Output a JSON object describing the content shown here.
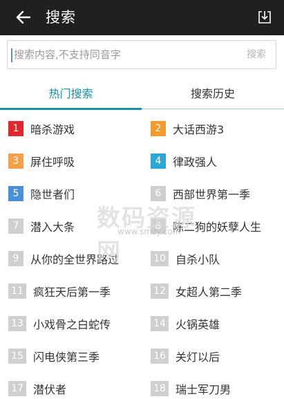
{
  "header": {
    "title": "搜索",
    "back_icon": "arrow-left-icon",
    "download_icon": "download-icon"
  },
  "search": {
    "placeholder": "搜索内容,不支持同音字",
    "button_label": "搜索"
  },
  "tabs": [
    {
      "label": "热门搜索",
      "active": true
    },
    {
      "label": "搜索历史",
      "active": false
    }
  ],
  "colors": {
    "header_bg": "#202020",
    "accent": "#1b8fa5",
    "rank_1": "#e0272b",
    "rank_2": "#f39a2a",
    "rank_3": "#f5a04a",
    "rank_4": "#29a8d8",
    "rank_5": "#4a90d9",
    "rank_other": "#cfcfcf"
  },
  "hot_items": [
    {
      "rank": "1",
      "label": "暗杀游戏"
    },
    {
      "rank": "2",
      "label": "大话西游3"
    },
    {
      "rank": "3",
      "label": "屏住呼吸"
    },
    {
      "rank": "4",
      "label": "律政强人"
    },
    {
      "rank": "5",
      "label": "隐世者们"
    },
    {
      "rank": "6",
      "label": "西部世界第一季"
    },
    {
      "rank": "7",
      "label": "潜入大条"
    },
    {
      "rank": "8",
      "label": "陈二狗的妖孽人生"
    },
    {
      "rank": "9",
      "label": "从你的全世界路过"
    },
    {
      "rank": "10",
      "label": "自杀小队"
    },
    {
      "rank": "11",
      "label": "疯狂天后第一季"
    },
    {
      "rank": "12",
      "label": "女超人第二季"
    },
    {
      "rank": "13",
      "label": "小戏骨之白蛇传"
    },
    {
      "rank": "14",
      "label": "火锅英雄"
    },
    {
      "rank": "15",
      "label": "闪电侠第三季"
    },
    {
      "rank": "16",
      "label": "关灯以后"
    },
    {
      "rank": "17",
      "label": "潜伏者"
    },
    {
      "rank": "18",
      "label": "瑞士军刀男"
    }
  ],
  "watermark": {
    "text": "数码资源网",
    "url": "www.smzy.com"
  }
}
